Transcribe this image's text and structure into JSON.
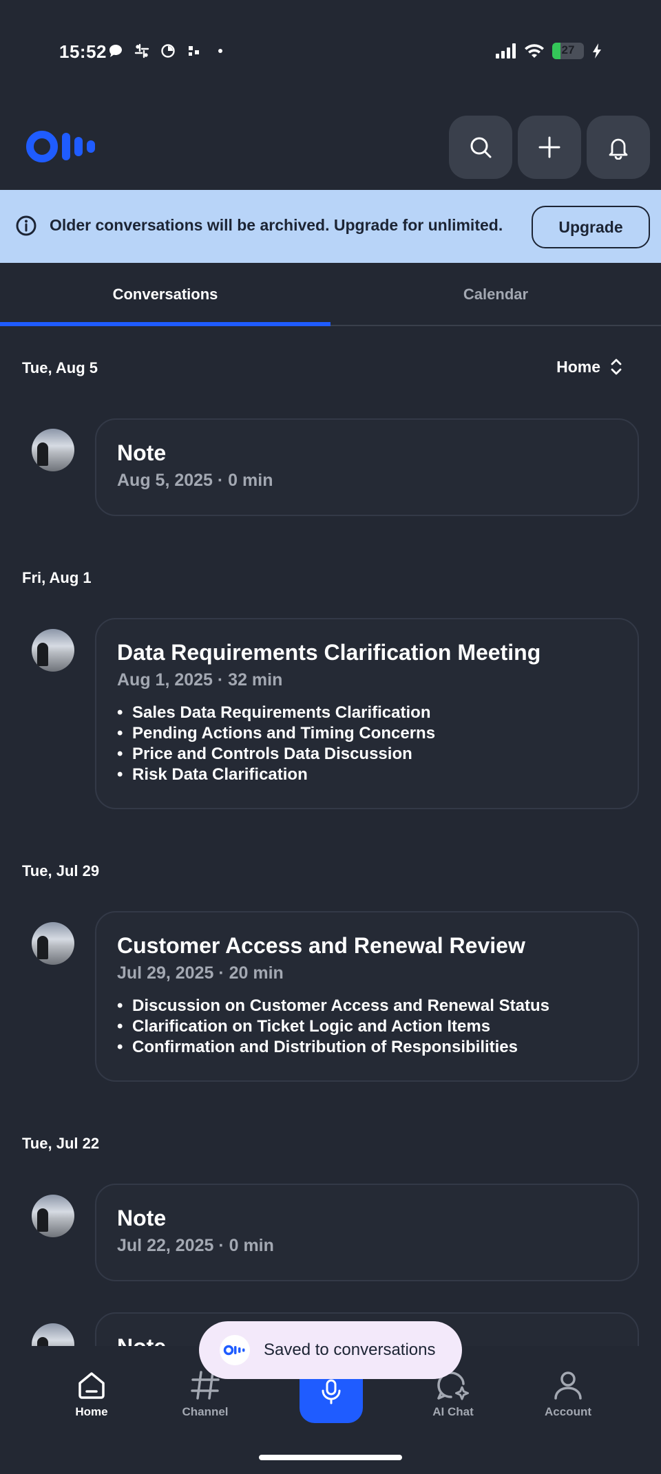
{
  "status_bar": {
    "time": "15:52",
    "battery": "27",
    "battery_level": 0.27
  },
  "banner": {
    "text": "Older conversations will be archived. Upgrade for unlimited.",
    "button": "Upgrade"
  },
  "tabs": {
    "conversations": "Conversations",
    "calendar": "Calendar"
  },
  "filter": {
    "label": "Home"
  },
  "groups": [
    {
      "date": "Tue, Aug 5",
      "title": "Note",
      "meta": "Aug 5, 2025 · 0 min",
      "bullets": []
    },
    {
      "date": "Fri, Aug 1",
      "title": "Data Requirements Clarification Meeting",
      "meta": "Aug 1, 2025 · 32 min",
      "bullets": [
        "Sales Data Requirements Clarification",
        "Pending Actions and Timing Concerns",
        "Price and Controls Data Discussion",
        "Risk Data Clarification"
      ]
    },
    {
      "date": "Tue, Jul 29",
      "title": "Customer Access and Renewal Review",
      "meta": "Jul 29, 2025 · 20 min",
      "bullets": [
        "Discussion on Customer Access and Renewal Status",
        "Clarification on Ticket Logic and Action Items",
        "Confirmation and Distribution of Responsibilities"
      ]
    },
    {
      "date": "Tue, Jul 22",
      "title": "Note",
      "meta": "Jul 22, 2025 · 0 min",
      "bullets": []
    },
    {
      "title": "Note"
    }
  ],
  "toast": {
    "text": "Saved to conversations"
  },
  "nav": {
    "home": "Home",
    "channel": "Channel",
    "ai_chat": "AI Chat",
    "account": "Account"
  },
  "colors": {
    "accent": "#1f5cff",
    "background": "#232833",
    "banner": "#b8d4f8"
  }
}
